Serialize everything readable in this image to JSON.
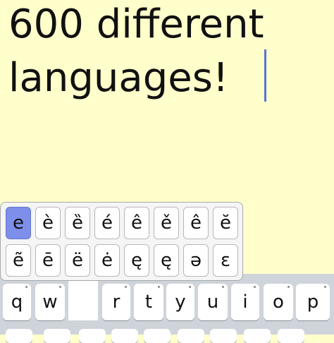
{
  "editor": {
    "lines": [
      "600 different",
      "languages!"
    ]
  },
  "accent_popup": {
    "selected": "e",
    "rows": [
      [
        "e",
        "è",
        "ȅ",
        "é",
        "ê",
        "ě",
        "ê",
        "ĕ"
      ],
      [
        "ẽ",
        "ē",
        "ë",
        "ė",
        "ę",
        "ę",
        "ə",
        "ɛ"
      ]
    ]
  },
  "keyboard": {
    "row1": [
      "q",
      "w",
      "",
      "r",
      "t",
      "y",
      "u",
      "i",
      "o",
      "p"
    ]
  }
}
